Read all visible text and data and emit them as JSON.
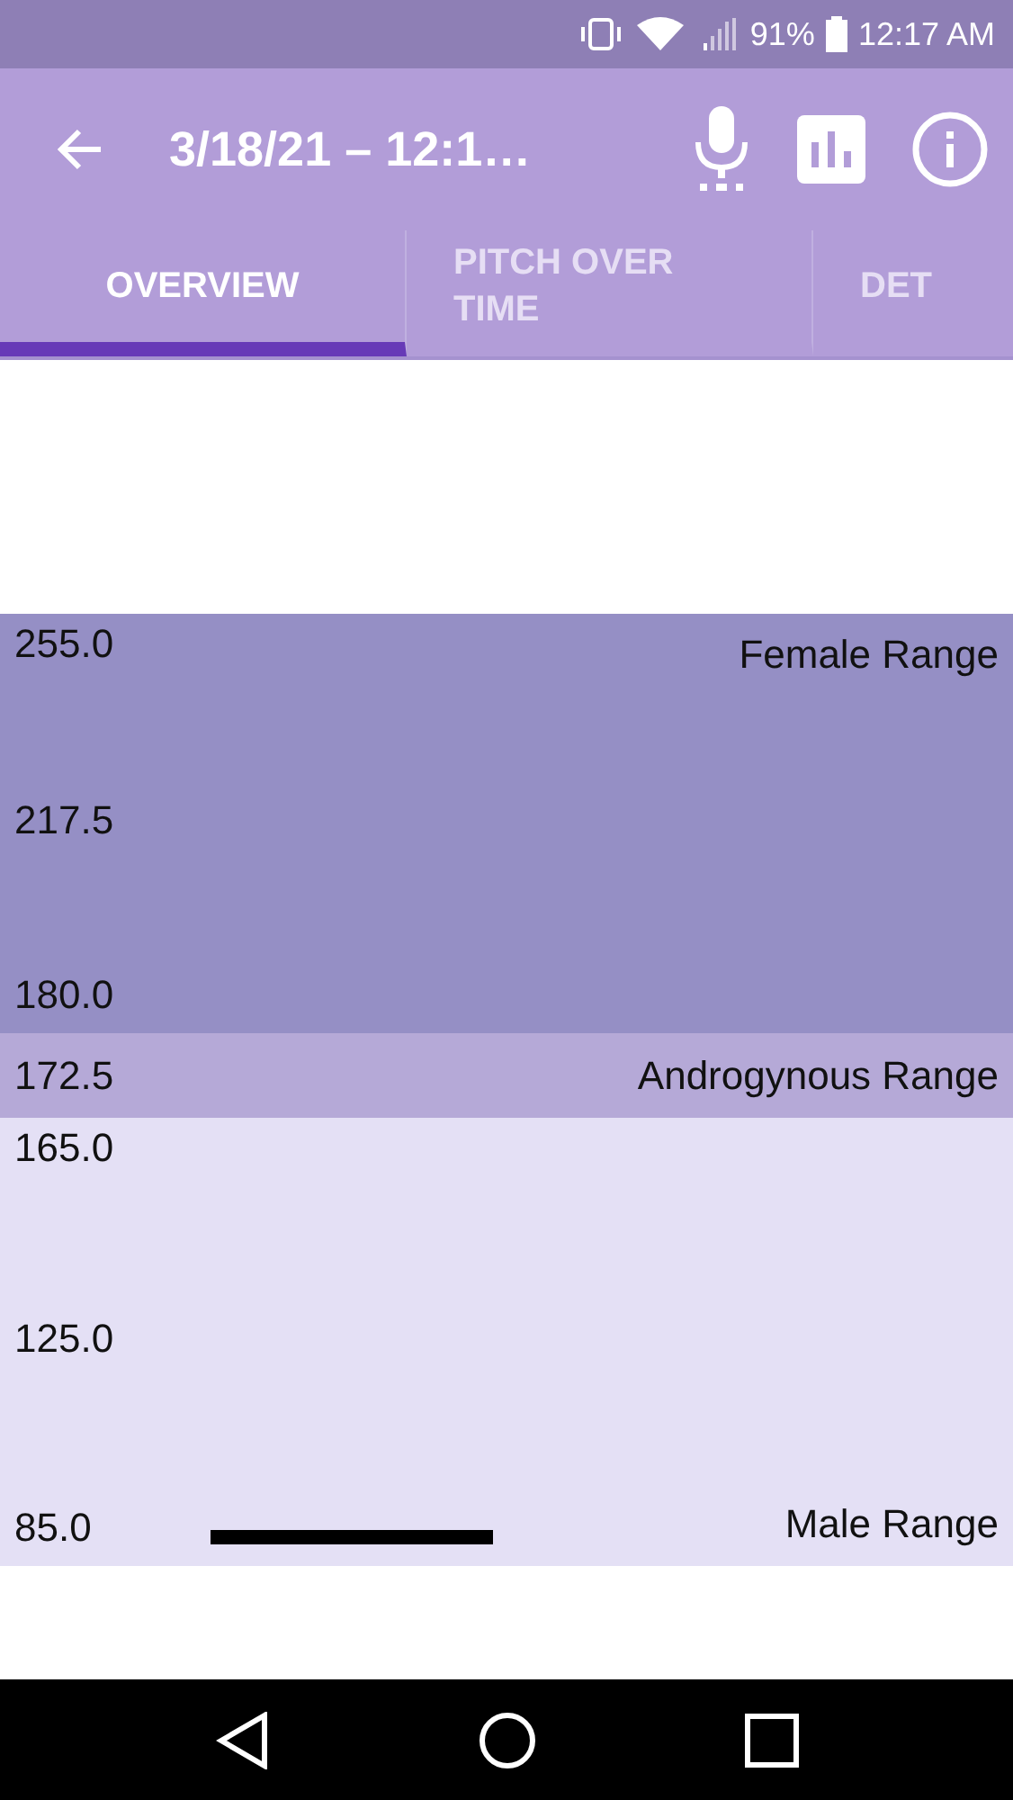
{
  "status_bar": {
    "battery": "91%",
    "time": "12:17 AM"
  },
  "app_bar": {
    "title": "3/18/21 – 12:1…"
  },
  "tabs": [
    {
      "label": "OVERVIEW",
      "selected": true
    },
    {
      "label": "PITCH OVER TIME",
      "selected": false
    },
    {
      "label": "DET",
      "selected": false
    }
  ],
  "bands": [
    {
      "kind": "top",
      "label": "Female Range",
      "color": "#958fc5",
      "ticks": [
        "255.0",
        "217.5",
        "180.0"
      ]
    },
    {
      "kind": "middle",
      "label": "Androgynous Range",
      "color": "#b5a9d7",
      "ticks": [
        "172.5"
      ]
    },
    {
      "kind": "bottom",
      "label": "Male Range",
      "color": "#e4e0f5",
      "ticks": [
        "165.0",
        "125.0",
        "85.0"
      ]
    }
  ]
}
